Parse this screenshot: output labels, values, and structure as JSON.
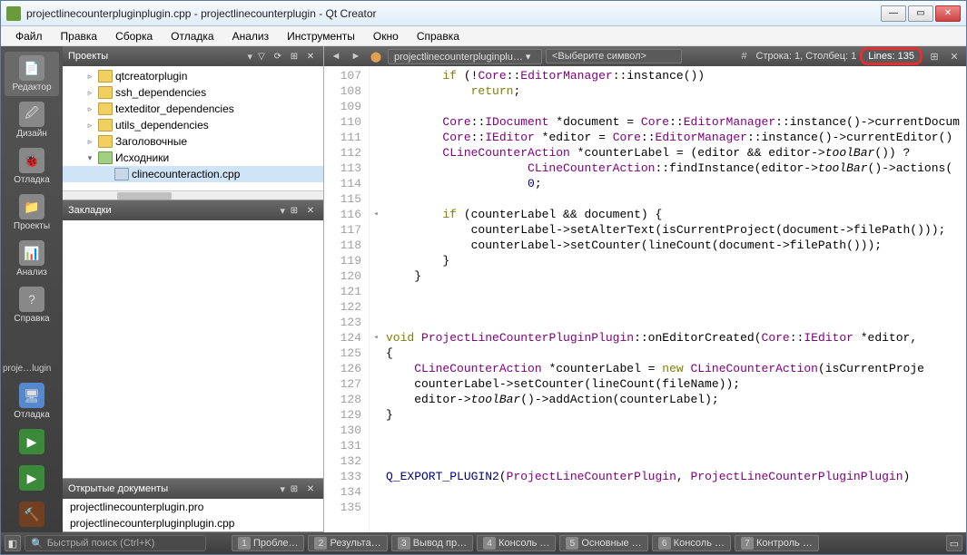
{
  "window": {
    "title": "projectlinecounterpluginplugin.cpp - projectlinecounterplugin - Qt Creator"
  },
  "menu": [
    "Файл",
    "Правка",
    "Сборка",
    "Отладка",
    "Анализ",
    "Инструменты",
    "Окно",
    "Справка"
  ],
  "leftbar": {
    "items": [
      {
        "label": "Редактор",
        "active": true,
        "icon": "📄"
      },
      {
        "label": "Дизайн",
        "icon": "🖉"
      },
      {
        "label": "Отладка",
        "icon": "🐞"
      },
      {
        "label": "Проекты",
        "icon": "📁"
      },
      {
        "label": "Анализ",
        "icon": "📊"
      },
      {
        "label": "Справка",
        "icon": "?"
      }
    ],
    "truncated": "proje…lugin",
    "debug": "Отладка",
    "run": "▶",
    "rundebug": "▶",
    "build": "🔨"
  },
  "projects": {
    "title": "Проекты",
    "items": [
      {
        "indent": 1,
        "exp": "▹",
        "name": "qtcreatorplugin"
      },
      {
        "indent": 1,
        "exp": "▹",
        "name": "ssh_dependencies"
      },
      {
        "indent": 1,
        "exp": "▹",
        "name": "texteditor_dependencies"
      },
      {
        "indent": 1,
        "exp": "▹",
        "name": "utils_dependencies"
      },
      {
        "indent": 1,
        "exp": "▹",
        "name": "Заголовочные"
      },
      {
        "indent": 1,
        "exp": "▾",
        "name": "Исходники",
        "src": true
      },
      {
        "indent": 2,
        "exp": "",
        "name": "clinecounteraction.cpp",
        "file": true,
        "sel": true
      }
    ]
  },
  "bookmarks": {
    "title": "Закладки"
  },
  "opendocs": {
    "title": "Открытые документы",
    "items": [
      "projectlinecounterplugin.pro",
      "projectlinecounterpluginplugin.cpp"
    ]
  },
  "editor": {
    "filename": "projectlinecounterpluginplu…",
    "symbol": "<Выберите символ>",
    "cursor": "Строка: 1, Столбец: 1",
    "lines": "Lines: 135",
    "linestart": 107,
    "code": [
      "        if (!Core::EditorManager::instance())",
      "            return;",
      "",
      "        Core::IDocument *document = Core::EditorManager::instance()->currentDocum",
      "        Core::IEditor *editor = Core::EditorManager::instance()->currentEditor()",
      "        CLineCounterAction *counterLabel = (editor && editor->toolBar()) ?",
      "                    CLineCounterAction::findInstance(editor->toolBar()->actions(",
      "                    0;",
      "",
      "        if (counterLabel && document) {",
      "            counterLabel->setAlterText(isCurrentProject(document->filePath()));",
      "            counterLabel->setCounter(lineCount(document->filePath()));",
      "        }",
      "    }",
      "",
      "",
      "",
      "void ProjectLineCounterPluginPlugin::onEditorCreated(Core::IEditor *editor,",
      "{",
      "    CLineCounterAction *counterLabel = new CLineCounterAction(isCurrentProje",
      "    counterLabel->setCounter(lineCount(fileName));",
      "    editor->toolBar()->addAction(counterLabel);",
      "}",
      "",
      "",
      "",
      "Q_EXPORT_PLUGIN2(ProjectLineCounterPlugin, ProjectLineCounterPluginPlugin)",
      "",
      ""
    ],
    "folds": {
      "116": "◂",
      "124": "◂"
    }
  },
  "status": {
    "search_placeholder": "Быстрый поиск (Ctrl+K)",
    "panes": [
      {
        "n": "1",
        "t": "Пробле…"
      },
      {
        "n": "2",
        "t": "Результа…"
      },
      {
        "n": "3",
        "t": "Вывод пр…"
      },
      {
        "n": "4",
        "t": "Консоль …"
      },
      {
        "n": "5",
        "t": "Основные …"
      },
      {
        "n": "6",
        "t": "Консоль …"
      },
      {
        "n": "7",
        "t": "Контроль …"
      }
    ]
  }
}
